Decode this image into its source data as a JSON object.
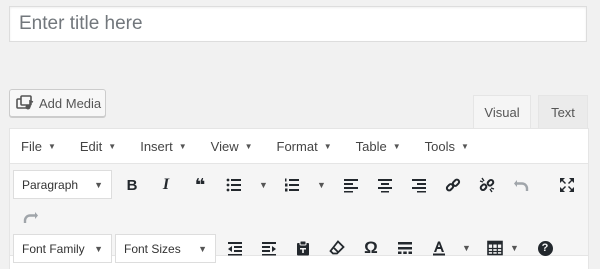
{
  "title": {
    "placeholder": "Enter title here",
    "value": ""
  },
  "media": {
    "add_label": "Add Media"
  },
  "tabs": {
    "visual": "Visual",
    "text": "Text"
  },
  "menu": [
    "File",
    "Edit",
    "Insert",
    "View",
    "Format",
    "Table",
    "Tools"
  ],
  "toolbar": {
    "format_select": "Paragraph",
    "font_family": "Font Family",
    "font_size": "Font Sizes",
    "bold_glyph": "B",
    "italic_glyph": "I",
    "quote_glyph": "❝",
    "omega_glyph": "Ω",
    "help_glyph": "?"
  },
  "colors": {
    "icon": "#23282d",
    "disabled_icon": "#a0a5aa",
    "toolbar_bg": "#f5f5f5",
    "border": "#e5e5e5"
  }
}
